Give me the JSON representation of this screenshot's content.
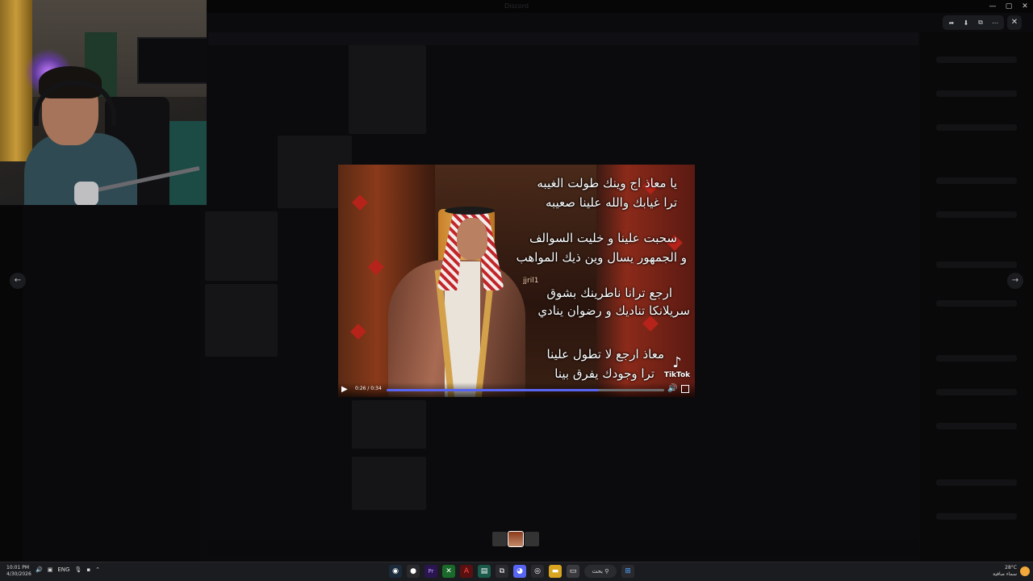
{
  "window": {
    "title": "Discord",
    "controls": [
      "—",
      "▢",
      "✕"
    ]
  },
  "viewer": {
    "toolbar": {
      "share_icon": "share-icon",
      "download_icon": "download-icon",
      "open_icon": "open-external-icon",
      "more_icon": "more-icon"
    },
    "close_label": "✕",
    "prev_label": "←",
    "next_label": "→"
  },
  "video": {
    "lyrics": [
      "يا معاذ اج وينك طولت الغيبه",
      "ترا غيابك والله علينا صعيبه",
      "سحبت علينا و خليت السوالف",
      "و الجمهور يسال وين ذيك المواهب",
      "ارجع ترانا ناطرينك بشوق",
      "سريلانكا تناديك و رضوان ينادي",
      "معاذ ارجع لا تطول علينا",
      "ترا وجودك يفرق بينا"
    ],
    "handle": "jjril1",
    "watermark": "TikTok",
    "time": "0:26 / 0:34",
    "progress": 0.765,
    "play_label": "▶",
    "volume_label": "🔊"
  },
  "taskbar": {
    "time": "10:01 PM",
    "date": "4/30/2026",
    "language": "ENG",
    "search_label": "بحث",
    "weather_temp": "28°C",
    "weather_desc": "سماء صافية"
  },
  "colors": {
    "accent": "#5865f2",
    "taskbar": "#1b1c1f"
  }
}
